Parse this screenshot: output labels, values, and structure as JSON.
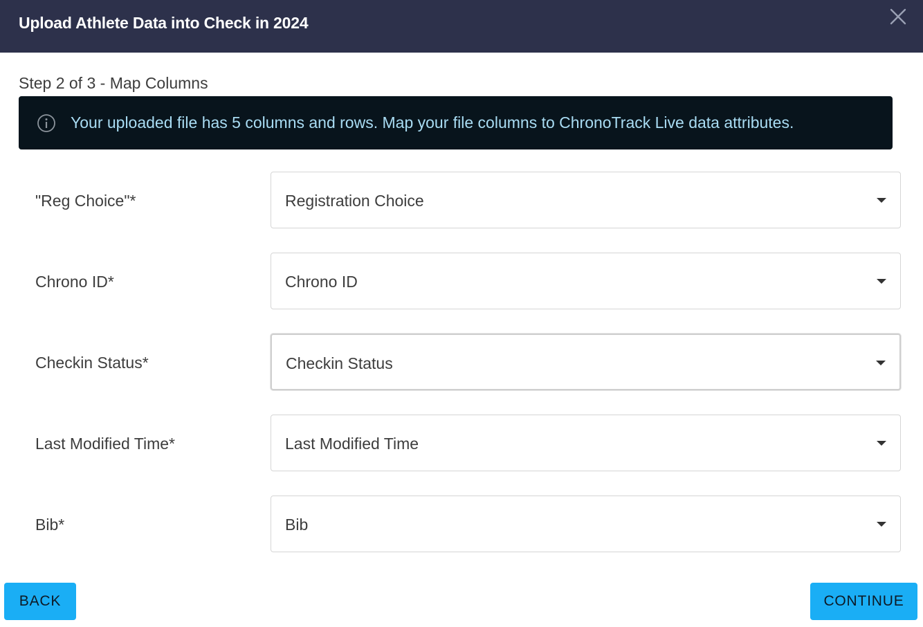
{
  "header": {
    "title": "Upload Athlete Data into Check in 2024",
    "close_icon": "close-icon"
  },
  "step": {
    "label": "Step 2 of 3 - Map Columns"
  },
  "info": {
    "icon": "info-icon",
    "text": "Your uploaded file has 5 columns and rows. Map your file columns to ChronoTrack Live data attributes."
  },
  "mappings": [
    {
      "label": "\"Reg Choice\"*",
      "value": "Registration Choice"
    },
    {
      "label": "Chrono ID*",
      "value": "Chrono ID"
    },
    {
      "label": "Checkin Status*",
      "value": "Checkin Status"
    },
    {
      "label": "Last Modified Time*",
      "value": "Last Modified Time"
    },
    {
      "label": "Bib*",
      "value": "Bib"
    }
  ],
  "footer": {
    "back_label": "BACK",
    "continue_label": "CONTINUE"
  },
  "colors": {
    "header_bg": "#2d314b",
    "banner_bg": "#08141c",
    "banner_text": "#a9dcf3",
    "button_bg": "#1aaef5"
  }
}
